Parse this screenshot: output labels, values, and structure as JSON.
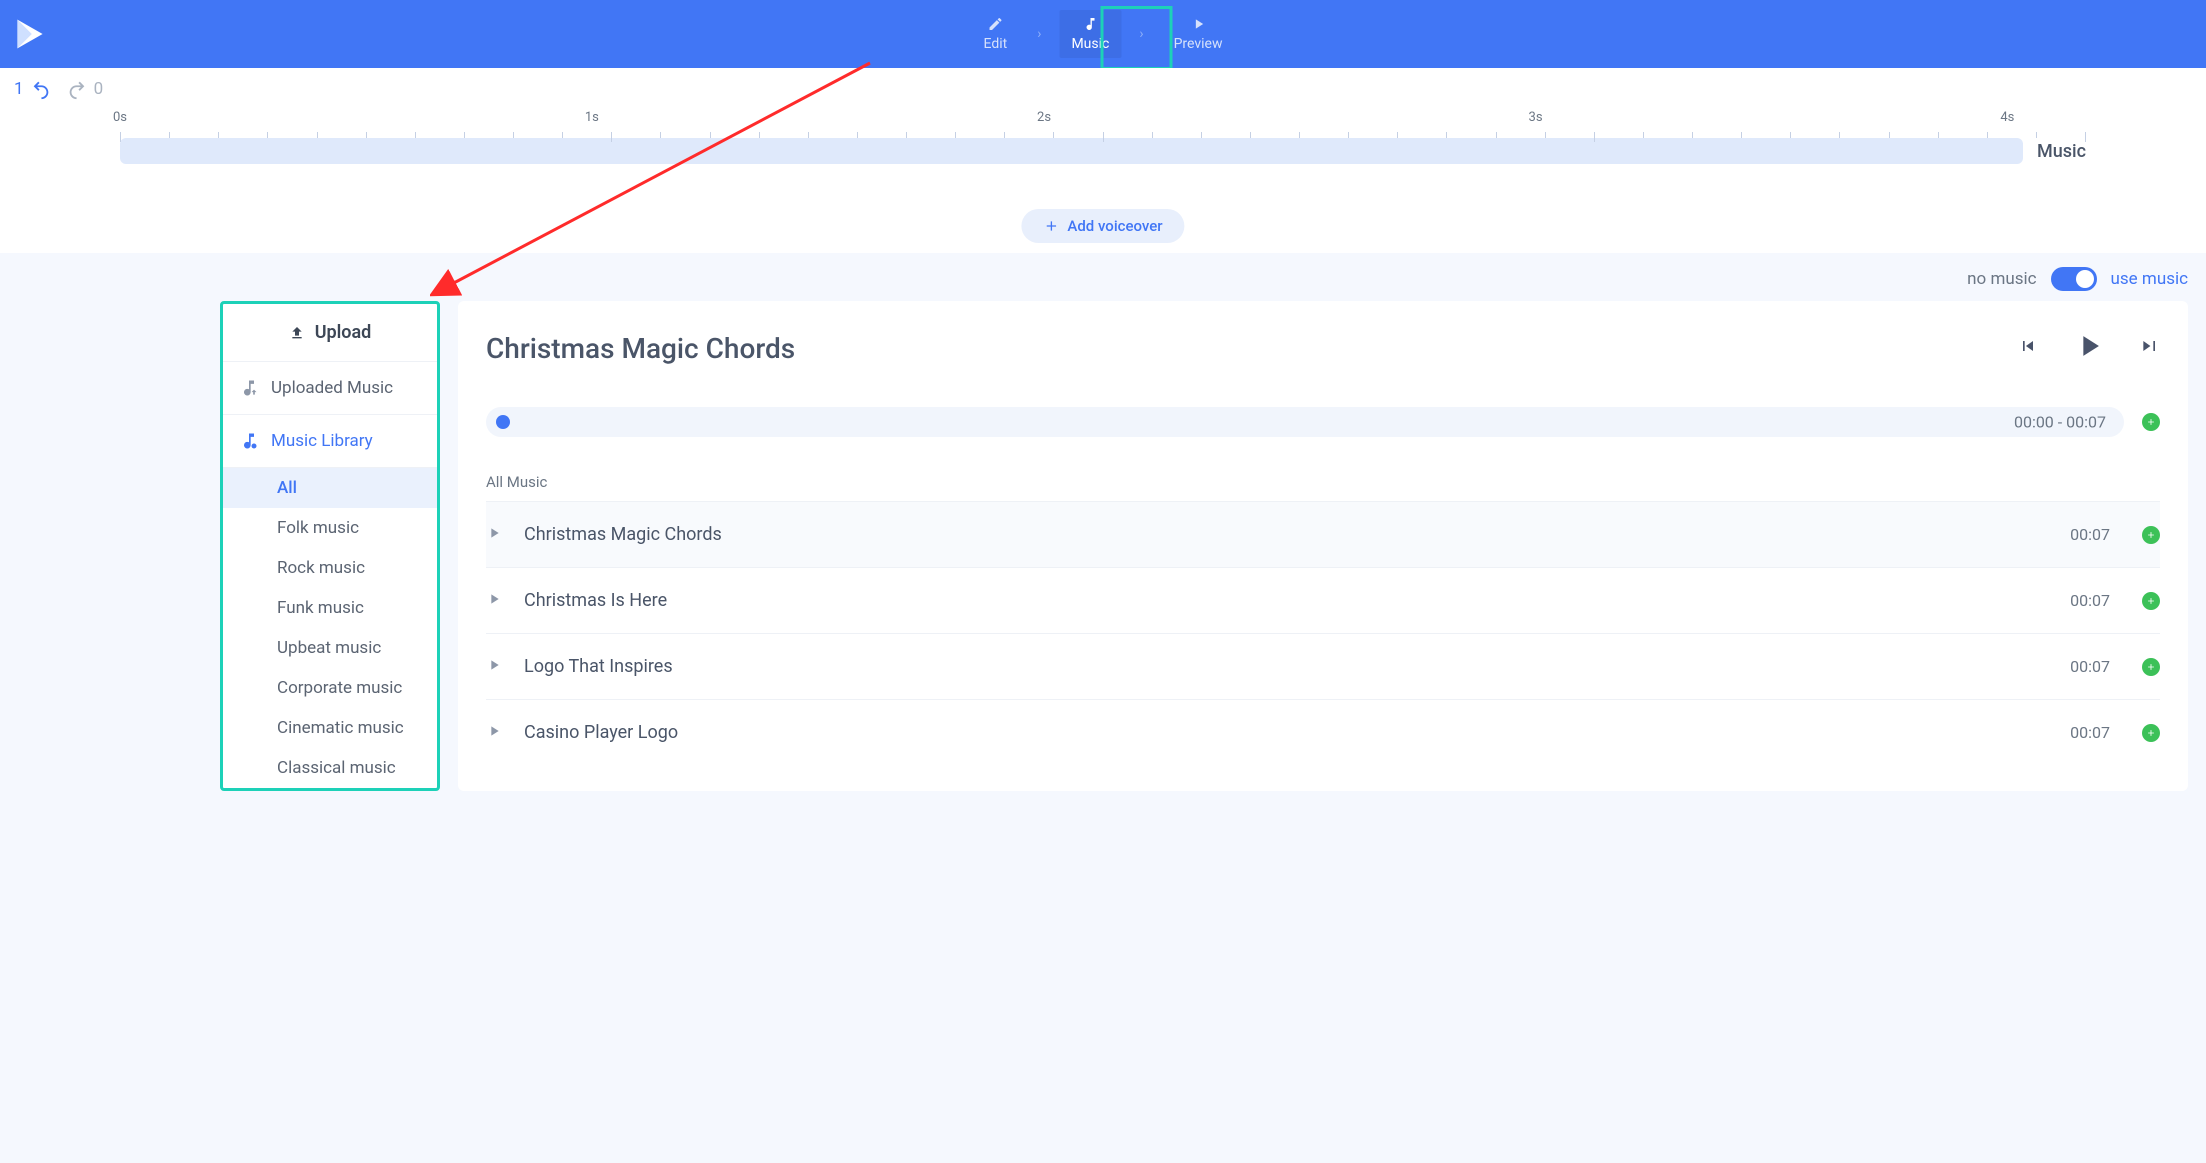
{
  "topnav": {
    "edit": "Edit",
    "music": "Music",
    "preview": "Preview"
  },
  "history": {
    "undo_count": "1",
    "redo_count": "0"
  },
  "timeline": {
    "t0": "0s",
    "t1": "1s",
    "t2": "2s",
    "t3": "3s",
    "t4": "4s",
    "track_label": "Music",
    "add_voiceover": "Add voiceover"
  },
  "music_toggle": {
    "off": "no music",
    "on": "use music"
  },
  "sidebar": {
    "upload": "Upload",
    "uploaded": "Uploaded Music",
    "library": "Music Library",
    "genres": [
      "All",
      "Folk music",
      "Rock music",
      "Funk music",
      "Upbeat music",
      "Corporate music",
      "Cinematic music",
      "Classical music"
    ]
  },
  "player": {
    "now_playing": "Christmas Magic Chords",
    "time_range": "00:00 - 00:07",
    "list_header": "All Music",
    "tracks": [
      {
        "name": "Christmas Magic Chords",
        "dur": "00:07"
      },
      {
        "name": "Christmas Is Here",
        "dur": "00:07"
      },
      {
        "name": "Logo That Inspires",
        "dur": "00:07"
      },
      {
        "name": "Casino Player Logo",
        "dur": "00:07"
      }
    ]
  }
}
